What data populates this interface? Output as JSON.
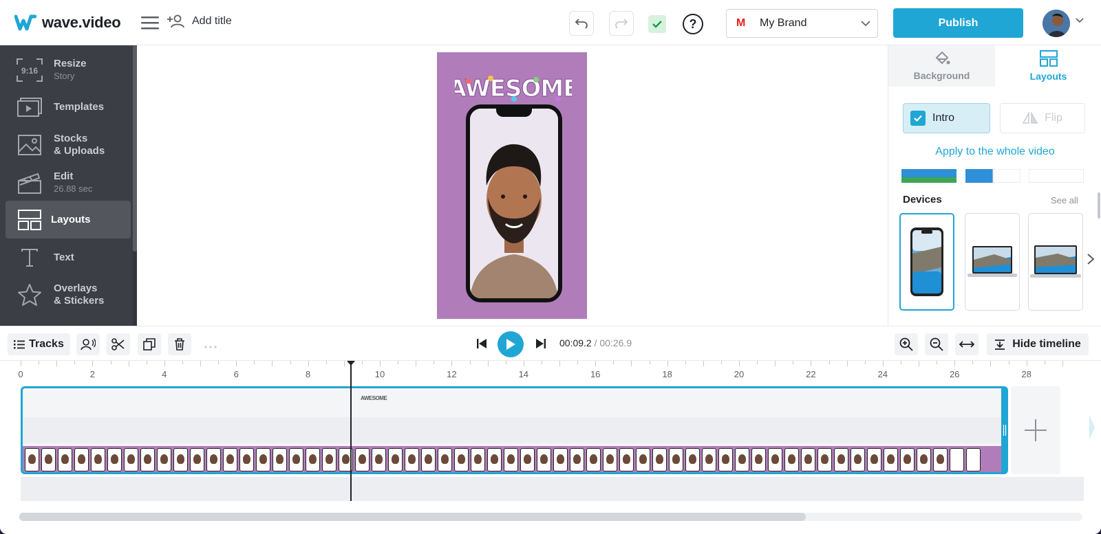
{
  "header": {
    "logo_text": "wave.video",
    "add_title_label": "Add title",
    "help_label": "?",
    "brand": {
      "initial": "M",
      "name": "My Brand"
    },
    "publish_label": "Publish"
  },
  "sidebar": {
    "items": [
      {
        "label": "Resize",
        "sub": "Story",
        "icon_text": "9:16",
        "icon": "resize-icon"
      },
      {
        "label": "Templates",
        "sub": "",
        "icon": "templates-icon"
      },
      {
        "label": "Stocks",
        "label2": "& Uploads",
        "icon": "image-icon"
      },
      {
        "label": "Edit",
        "sub": "26.88 sec",
        "icon": "clapper-icon"
      },
      {
        "label": "Layouts",
        "sub": "",
        "icon": "layouts-icon",
        "active": true
      },
      {
        "label": "Text",
        "sub": "",
        "icon": "text-icon"
      },
      {
        "label": "Overlays",
        "label2": "& Stickers",
        "icon": "star-icon"
      }
    ]
  },
  "preview": {
    "sticker_text": "AWESOME"
  },
  "right_panel": {
    "tabs": [
      {
        "label": "Background",
        "icon": "paint-bucket-icon"
      },
      {
        "label": "Layouts",
        "icon": "layouts-icon",
        "active": true
      }
    ],
    "intro_label": "Intro",
    "flip_label": "Flip",
    "apply_link": "Apply to the whole video",
    "devices_title": "Devices",
    "see_all": "See all"
  },
  "toolbar": {
    "tracks_label": "Tracks",
    "time_current": "00:09.2",
    "time_separator": " / ",
    "time_total": "00:26.9",
    "hide_timeline_label": "Hide timeline"
  },
  "timeline": {
    "ruler_labels": [
      "0",
      "2",
      "4",
      "6",
      "8",
      "10",
      "12",
      "14",
      "16",
      "18",
      "20",
      "22",
      "24",
      "26",
      "28"
    ],
    "playhead_seconds": 9.2,
    "duration_seconds": 26.9,
    "clip_sticker_text": "AWESOME"
  },
  "colors": {
    "accent": "#1fa6d4",
    "sidebar_bg": "#3b3f45",
    "preview_bg": "#b07dba",
    "brand_red": "#e0231b"
  }
}
